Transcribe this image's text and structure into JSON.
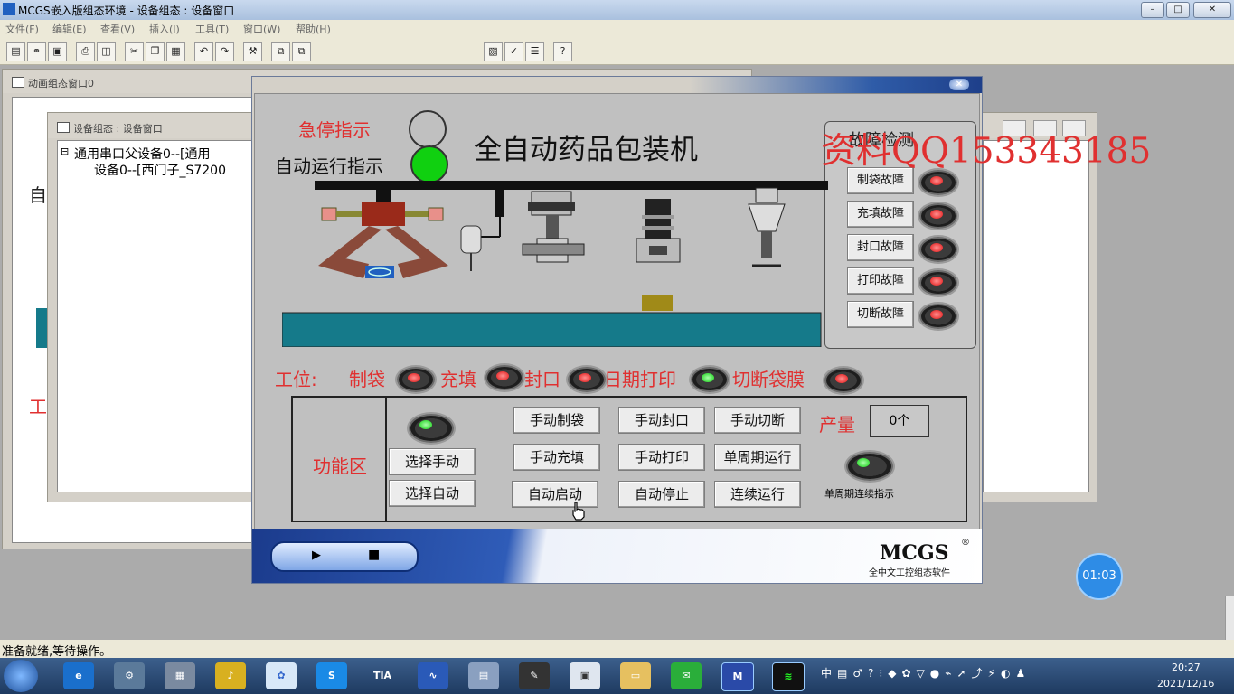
{
  "app": {
    "title": "MCGS嵌入版组态环境 - 设备组态 : 设备窗口"
  },
  "menu": [
    "文件(F)",
    "编辑(E)",
    "查看(V)",
    "插入(I)",
    "工具(T)",
    "窗口(W)",
    "帮助(H)"
  ],
  "windows": {
    "animation": {
      "title": "动画组态窗口0",
      "side_chars": [
        "自",
        "工"
      ]
    },
    "device": {
      "title": "设备组态 : 设备窗口",
      "tree": [
        "通用串口父设备0--[通用",
        "设备0--[西门子_S7200"
      ]
    }
  },
  "dialog": {
    "title": "全自动药品包装机",
    "estop_label": "急停指示",
    "auto_label": "自动运行指示",
    "watermark": "资料QQ153343185",
    "fault_panel": {
      "header": "故障检测",
      "items": [
        "制袋故障",
        "充填故障",
        "封口故障",
        "打印故障",
        "切断故障"
      ]
    },
    "station": {
      "label": "工位:",
      "items": [
        "制袋",
        "充填",
        "封口",
        "日期打印",
        "切断袋膜"
      ]
    },
    "function_area": {
      "label": "功能区",
      "buttons": {
        "select_manual": "选择手动",
        "select_auto": "选择自动",
        "manual_bag": "手动制袋",
        "manual_fill": "手动充填",
        "auto_start": "自动启动",
        "manual_seal": "手动封口",
        "manual_print": "手动打印",
        "auto_stop": "自动停止",
        "manual_cut": "手动切断",
        "single_cycle": "单周期运行",
        "continuous": "连续运行"
      },
      "output_label": "产量",
      "output_value": "0个",
      "cycle_indicator_label": "单周期连续指示"
    },
    "logo": "MCGS",
    "logo_sub": "全中文工控组态软件"
  },
  "status": "准备就绪,等待操作。",
  "timer": "01:03",
  "clock": {
    "time": "20:27",
    "date": "2021/12/16"
  },
  "colors": {
    "red_text": "#e03030",
    "conveyor": "#157a8a",
    "lamp_green": "#10d010",
    "lamp_red": "#e01010"
  }
}
